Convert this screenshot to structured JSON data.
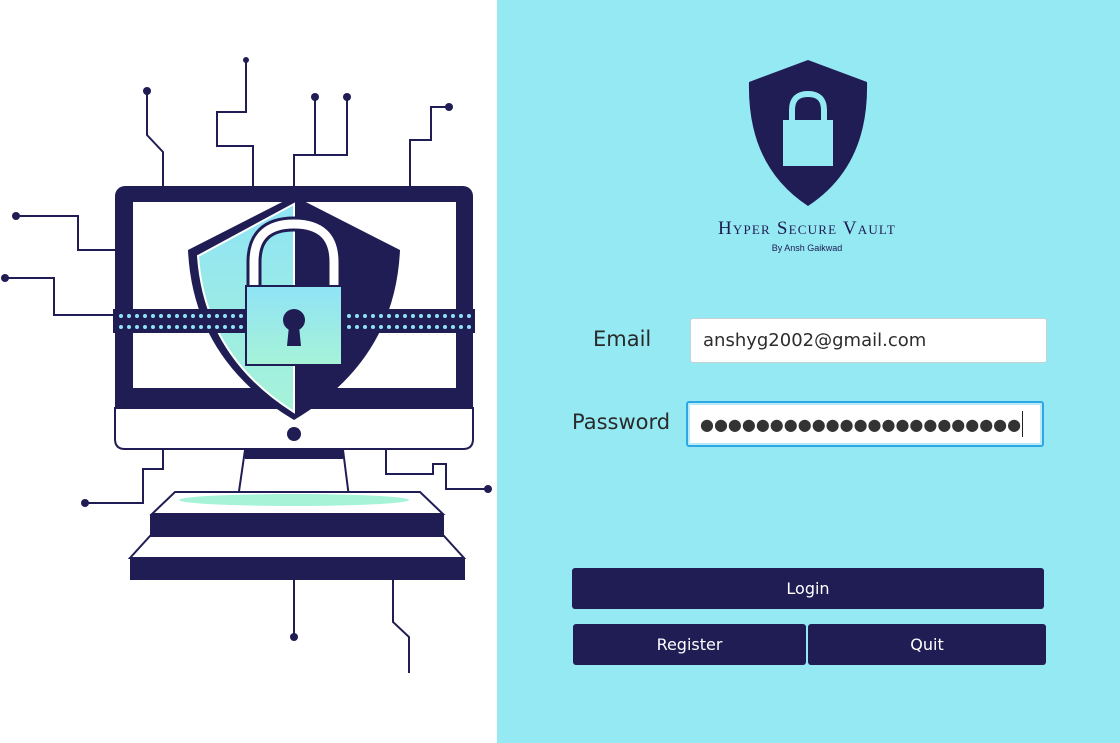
{
  "brand": {
    "title": "Hyper Secure Vault",
    "subtitle": "By Ansh Gaikwad"
  },
  "form": {
    "email_label": "Email",
    "email_value": "anshyg2002@gmail.com",
    "password_label": "Password",
    "password_mask": "●●●●●●●●●●●●●●●●●●●●●●●"
  },
  "buttons": {
    "login": "Login",
    "register": "Register",
    "quit": "Quit"
  },
  "colors": {
    "navy": "#201d55",
    "panel_cyan": "#94e9f3",
    "accent_light": "#a3f0e0"
  },
  "icons": {
    "illustration": "computer-shield-lock-illustration",
    "logo": "shield-lock-icon"
  }
}
